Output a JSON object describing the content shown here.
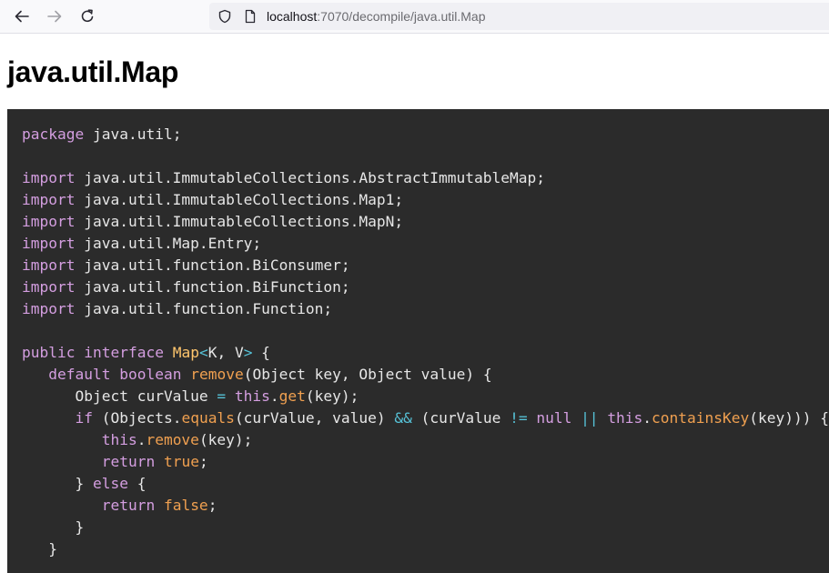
{
  "browser": {
    "nav_icons": [
      "back-arrow-icon",
      "forward-arrow-icon",
      "reload-icon"
    ],
    "address_icons": [
      "shield-icon",
      "page-icon"
    ],
    "url_host": "localhost",
    "url_rest": ":7070/decompile/java.util.Map"
  },
  "page": {
    "title": "java.util.Map"
  },
  "code": {
    "background": "#2b2b2b",
    "colors": {
      "keyword": "#d49ee0",
      "type": "#ffc66d",
      "method": "#f0a050",
      "operator": "#56c1d6",
      "plain": "#e6e6e6"
    },
    "tokens": {
      "package_kw": "package",
      "import_kw": "import",
      "public_kw": "public",
      "interface_kw": "interface",
      "default_kw": "default",
      "boolean_kw": "boolean",
      "this_kw": "this",
      "if_kw": "if",
      "return_kw": "return",
      "else_kw": "else",
      "null_kw": "null",
      "true_kw": "true",
      "false_kw": "false",
      "type_name": "Map",
      "remove_m": "remove",
      "get_m": "get",
      "equals_m": "equals",
      "containsKey_m": "containsKey",
      "lt": "<",
      "gt": ">",
      "eq": "=",
      "and": "&&",
      "neq": "!=",
      "or": "||"
    },
    "text": {
      "package_name": " java.util;",
      "imports": [
        " java.util.ImmutableCollections.AbstractImmutableMap;",
        " java.util.ImmutableCollections.Map1;",
        " java.util.ImmutableCollections.MapN;",
        " java.util.Map.Entry;",
        " java.util.function.BiConsumer;",
        " java.util.function.BiFunction;",
        " java.util.function.Function;"
      ],
      "type_params": "K, V",
      "open_brace": " {",
      "remove_params": "(Object key, Object value) {",
      "obj_decl": "Object curValue ",
      "get_args": "(key);",
      "objects_call": " (Objects.",
      "equals_args": "(curValue, value) ",
      "paren_cur": " (curValue ",
      "space": " ",
      "space2": " ",
      "contains_args": "(key))) {",
      "remove_args": "(key);",
      "semicolon": ";",
      "semicolon2": ";",
      "close_brace": "}",
      "close_else": "} ",
      "else_open": " {",
      "close_inner": "}",
      "close_method": "}"
    }
  }
}
